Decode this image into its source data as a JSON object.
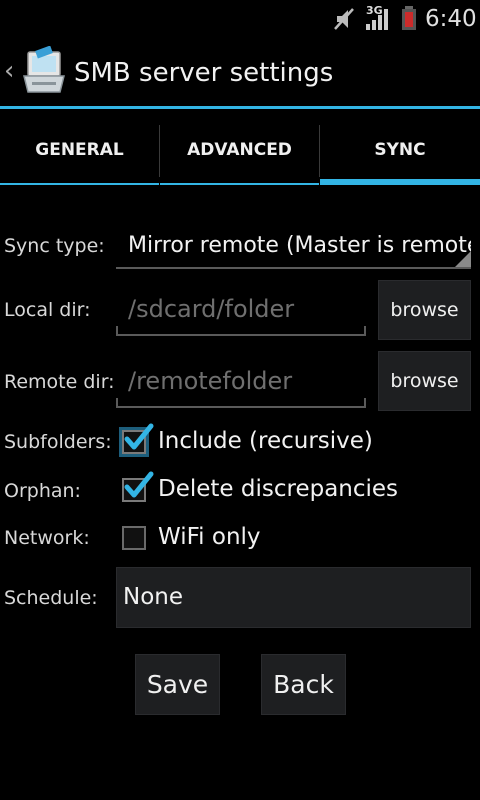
{
  "status_bar": {
    "network": "3G",
    "time": "6:40",
    "icons": [
      "mute-icon",
      "signal-icon",
      "battery-low-icon"
    ]
  },
  "action_bar": {
    "title": "SMB server settings",
    "back_icon": "chevron-left-icon",
    "app_icon": "network-drive-icon"
  },
  "tabs": [
    {
      "label": "GENERAL",
      "active": false
    },
    {
      "label": "ADVANCED",
      "active": false
    },
    {
      "label": "SYNC",
      "active": true
    }
  ],
  "form": {
    "sync_type": {
      "label": "Sync type:",
      "value": "Mirror remote (Master is remote)"
    },
    "local_dir": {
      "label": "Local dir:",
      "placeholder": "/sdcard/folder",
      "value": "",
      "button": "browse"
    },
    "remote_dir": {
      "label": "Remote dir:",
      "placeholder": "/remotefolder",
      "value": "",
      "button": "browse"
    },
    "subfolders": {
      "label": "Subfolders:",
      "text": "Include (recursive)",
      "checked": true
    },
    "orphan": {
      "label": "Orphan:",
      "text": "Delete discrepancies",
      "checked": true
    },
    "network": {
      "label": "Network:",
      "text": "WiFi only",
      "checked": false
    },
    "schedule": {
      "label": "Schedule:",
      "value": "None"
    }
  },
  "buttons": {
    "save": "Save",
    "back": "Back"
  },
  "colors": {
    "accent": "#33b5e5",
    "background": "#000000",
    "button_bg": "#1e1f21"
  }
}
